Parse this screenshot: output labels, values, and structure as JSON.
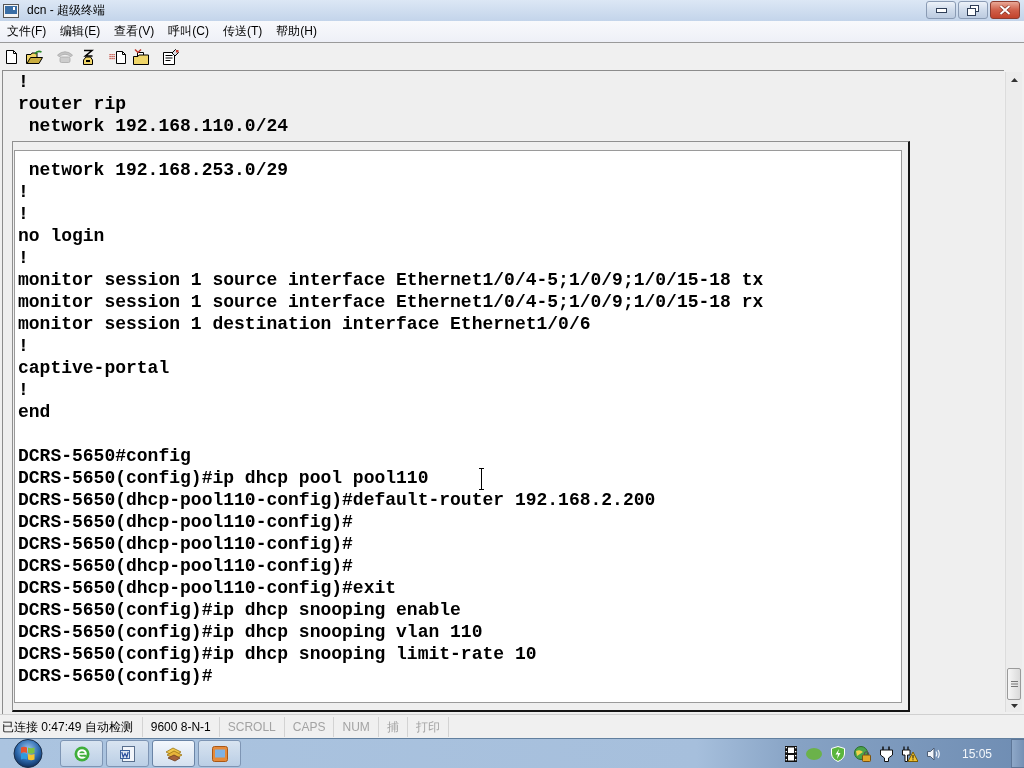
{
  "window": {
    "title": "dcn - 超级终端"
  },
  "menu": [
    "文件(F)",
    "编辑(E)",
    "查看(V)",
    "呼叫(C)",
    "传送(T)",
    "帮助(H)"
  ],
  "toolbar": [
    {
      "buttons": [
        {
          "kind": "new",
          "disabled": false
        },
        {
          "kind": "open",
          "disabled": false
        }
      ]
    },
    {
      "buttons": [
        {
          "kind": "hangup",
          "disabled": true
        },
        {
          "kind": "call",
          "disabled": false
        }
      ]
    },
    {
      "buttons": [
        {
          "kind": "send",
          "disabled": false
        },
        {
          "kind": "receive",
          "disabled": false
        }
      ]
    },
    {
      "buttons": [
        {
          "kind": "properties",
          "disabled": false
        }
      ]
    }
  ],
  "terminal": {
    "lines": [
      "!",
      "router rip",
      " network 192.168.110.0/24"
    ],
    "panel": {
      "sections": [
        {
          "lines": [
            " network 192.168.253.0/29",
            "!",
            "!",
            "no login",
            "!",
            "monitor session 1 source interface Ethernet1/0/4-5;1/0/9;1/0/15-18 tx",
            "monitor session 1 source interface Ethernet1/0/4-5;1/0/9;1/0/15-18 rx",
            "monitor session 1 destination interface Ethernet1/0/6",
            "!",
            "captive-portal",
            "!",
            "end"
          ]
        },
        {
          "lines": [
            "DCRS-5650#config",
            "DCRS-5650(config)#ip dhcp pool pool110",
            "DCRS-5650(dhcp-pool110-config)#default-router 192.168.2.200",
            "DCRS-5650(dhcp-pool110-config)#",
            "DCRS-5650(dhcp-pool110-config)#",
            "DCRS-5650(dhcp-pool110-config)#",
            "DCRS-5650(dhcp-pool110-config)#exit",
            "DCRS-5650(config)#ip dhcp snooping enable",
            "DCRS-5650(config)#ip dhcp snooping vlan 110",
            "DCRS-5650(config)#ip dhcp snooping limit-rate 10",
            "DCRS-5650(config)#"
          ]
        }
      ]
    }
  },
  "status_bar": [
    {
      "text": "已连接 0:47:49 自动检测",
      "disabled": false
    },
    {
      "text": "9600 8-N-1",
      "disabled": false
    },
    {
      "text": "SCROLL",
      "disabled": true
    },
    {
      "text": "CAPS",
      "disabled": true
    },
    {
      "text": "NUM",
      "disabled": true
    },
    {
      "text": "捕",
      "disabled": true
    },
    {
      "text": "打印",
      "disabled": true
    }
  ],
  "taskbar": {
    "buttons": [
      {
        "kind": "browser",
        "selected": false
      },
      {
        "kind": "document",
        "selected": false
      },
      {
        "kind": "terminal",
        "selected": true
      },
      {
        "kind": "window",
        "selected": false
      }
    ],
    "clock": "15:05"
  }
}
